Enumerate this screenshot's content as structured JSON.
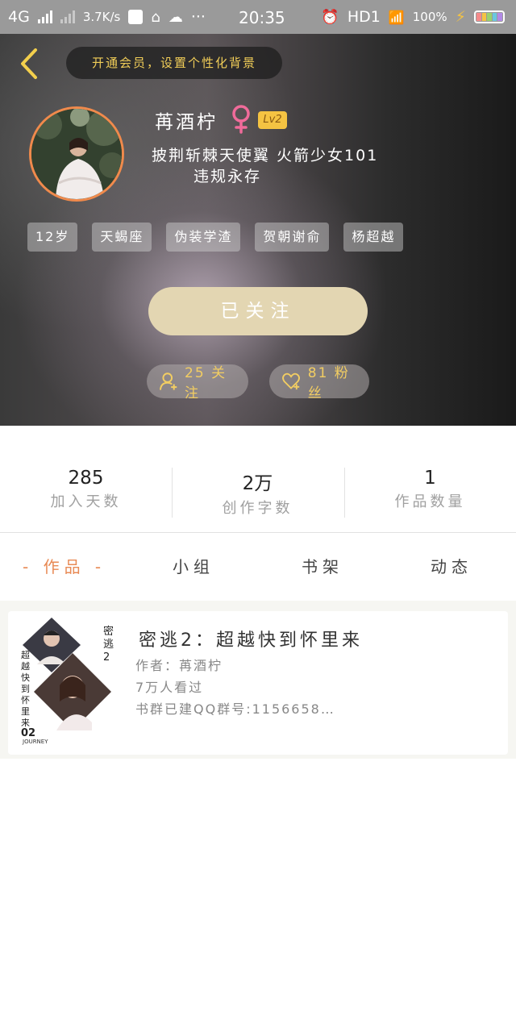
{
  "status_bar": {
    "network": "4G",
    "speed": "3.7K/s",
    "time": "20:35",
    "hd": "HD1",
    "battery": "100%"
  },
  "header": {
    "vip_banner": "开通会员，设置个性化背景"
  },
  "profile": {
    "username": "苒酒柠",
    "level": "Lv2",
    "bio_line1": "披荆斩棘天使翼 火箭少女101",
    "bio_line2": "违规永存",
    "tags": [
      "12岁",
      "天蝎座",
      "伪装学渣",
      "贺朝谢俞",
      "杨超越"
    ],
    "follow_button": "已关注",
    "following_count": "25 关注",
    "fans_count": "81 粉丝"
  },
  "stats": [
    {
      "value": "285",
      "label": "加入天数"
    },
    {
      "value": "2万",
      "label": "创作字数"
    },
    {
      "value": "1",
      "label": "作品数量"
    }
  ],
  "tabs": [
    "- 作品 -",
    "小组",
    "书架",
    "动态"
  ],
  "works": [
    {
      "cover": {
        "title_vertical": "密逃2",
        "subtitle_vertical": "超越快到怀里来",
        "number": "02",
        "english": "JOURNEY"
      },
      "title": "密逃2：超越快到怀里来",
      "author": "作者：苒酒柠",
      "views": "7万人看过",
      "description": "书群已建QQ群号:1156658…"
    }
  ],
  "colors": {
    "accent": "#f1cd58",
    "follow_button": "#e3d6b2",
    "active_tab": "#e88a55",
    "avatar_ring": "#f08a4c",
    "level_badge": "#f5c342"
  }
}
